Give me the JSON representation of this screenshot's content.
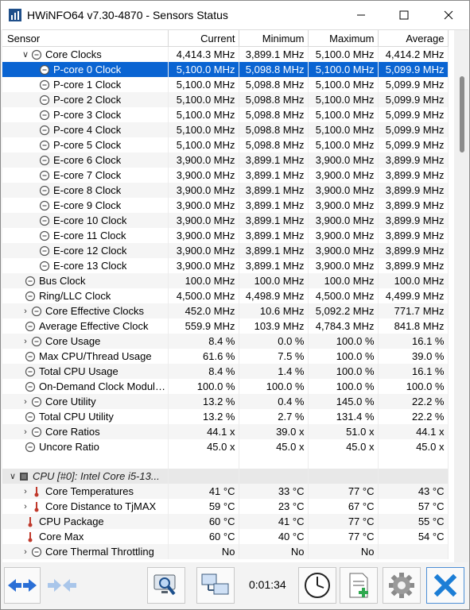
{
  "window": {
    "title": "HWiNFO64 v7.30-4870 - Sensors Status"
  },
  "columns": [
    "Sensor",
    "Current",
    "Minimum",
    "Maximum",
    "Average"
  ],
  "rows": [
    {
      "indent": 1,
      "expander": "v",
      "icon": "clock-icon",
      "name": "Core Clocks",
      "current": "4,414.3 MHz",
      "minimum": "3,899.1 MHz",
      "maximum": "5,100.0 MHz",
      "average": "4,414.2 MHz",
      "selected": false
    },
    {
      "indent": 2,
      "expander": "",
      "icon": "clock-icon",
      "name": "P-core 0 Clock",
      "current": "5,100.0 MHz",
      "minimum": "5,098.8 MHz",
      "maximum": "5,100.0 MHz",
      "average": "5,099.9 MHz",
      "selected": true
    },
    {
      "indent": 2,
      "expander": "",
      "icon": "clock-icon",
      "name": "P-core 1 Clock",
      "current": "5,100.0 MHz",
      "minimum": "5,098.8 MHz",
      "maximum": "5,100.0 MHz",
      "average": "5,099.9 MHz",
      "selected": false
    },
    {
      "indent": 2,
      "expander": "",
      "icon": "clock-icon",
      "name": "P-core 2 Clock",
      "current": "5,100.0 MHz",
      "minimum": "5,098.8 MHz",
      "maximum": "5,100.0 MHz",
      "average": "5,099.9 MHz",
      "selected": false
    },
    {
      "indent": 2,
      "expander": "",
      "icon": "clock-icon",
      "name": "P-core 3 Clock",
      "current": "5,100.0 MHz",
      "minimum": "5,098.8 MHz",
      "maximum": "5,100.0 MHz",
      "average": "5,099.9 MHz",
      "selected": false
    },
    {
      "indent": 2,
      "expander": "",
      "icon": "clock-icon",
      "name": "P-core 4 Clock",
      "current": "5,100.0 MHz",
      "minimum": "5,098.8 MHz",
      "maximum": "5,100.0 MHz",
      "average": "5,099.9 MHz",
      "selected": false
    },
    {
      "indent": 2,
      "expander": "",
      "icon": "clock-icon",
      "name": "P-core 5 Clock",
      "current": "5,100.0 MHz",
      "minimum": "5,098.8 MHz",
      "maximum": "5,100.0 MHz",
      "average": "5,099.9 MHz",
      "selected": false
    },
    {
      "indent": 2,
      "expander": "",
      "icon": "clock-icon",
      "name": "E-core 6 Clock",
      "current": "3,900.0 MHz",
      "minimum": "3,899.1 MHz",
      "maximum": "3,900.0 MHz",
      "average": "3,899.9 MHz",
      "selected": false
    },
    {
      "indent": 2,
      "expander": "",
      "icon": "clock-icon",
      "name": "E-core 7 Clock",
      "current": "3,900.0 MHz",
      "minimum": "3,899.1 MHz",
      "maximum": "3,900.0 MHz",
      "average": "3,899.9 MHz",
      "selected": false
    },
    {
      "indent": 2,
      "expander": "",
      "icon": "clock-icon",
      "name": "E-core 8 Clock",
      "current": "3,900.0 MHz",
      "minimum": "3,899.1 MHz",
      "maximum": "3,900.0 MHz",
      "average": "3,899.9 MHz",
      "selected": false
    },
    {
      "indent": 2,
      "expander": "",
      "icon": "clock-icon",
      "name": "E-core 9 Clock",
      "current": "3,900.0 MHz",
      "minimum": "3,899.1 MHz",
      "maximum": "3,900.0 MHz",
      "average": "3,899.9 MHz",
      "selected": false
    },
    {
      "indent": 2,
      "expander": "",
      "icon": "clock-icon",
      "name": "E-core 10 Clock",
      "current": "3,900.0 MHz",
      "minimum": "3,899.1 MHz",
      "maximum": "3,900.0 MHz",
      "average": "3,899.9 MHz",
      "selected": false
    },
    {
      "indent": 2,
      "expander": "",
      "icon": "clock-icon",
      "name": "E-core 11 Clock",
      "current": "3,900.0 MHz",
      "minimum": "3,899.1 MHz",
      "maximum": "3,900.0 MHz",
      "average": "3,899.9 MHz",
      "selected": false
    },
    {
      "indent": 2,
      "expander": "",
      "icon": "clock-icon",
      "name": "E-core 12 Clock",
      "current": "3,900.0 MHz",
      "minimum": "3,899.1 MHz",
      "maximum": "3,900.0 MHz",
      "average": "3,899.9 MHz",
      "selected": false
    },
    {
      "indent": 2,
      "expander": "",
      "icon": "clock-icon",
      "name": "E-core 13 Clock",
      "current": "3,900.0 MHz",
      "minimum": "3,899.1 MHz",
      "maximum": "3,900.0 MHz",
      "average": "3,899.9 MHz",
      "selected": false
    },
    {
      "indent": 0,
      "expander": "",
      "icon": "clock-icon",
      "name": "Bus Clock",
      "current": "100.0 MHz",
      "minimum": "100.0 MHz",
      "maximum": "100.0 MHz",
      "average": "100.0 MHz",
      "selected": false
    },
    {
      "indent": 0,
      "expander": "",
      "icon": "clock-icon",
      "name": "Ring/LLC Clock",
      "current": "4,500.0 MHz",
      "minimum": "4,498.9 MHz",
      "maximum": "4,500.0 MHz",
      "average": "4,499.9 MHz",
      "selected": false
    },
    {
      "indent": 1,
      "expander": ">",
      "icon": "clock-icon",
      "name": "Core Effective Clocks",
      "current": "452.0 MHz",
      "minimum": "10.6 MHz",
      "maximum": "5,092.2 MHz",
      "average": "771.7 MHz",
      "selected": false
    },
    {
      "indent": 0,
      "expander": "",
      "icon": "clock-icon",
      "name": "Average Effective Clock",
      "current": "559.9 MHz",
      "minimum": "103.9 MHz",
      "maximum": "4,784.3 MHz",
      "average": "841.8 MHz",
      "selected": false
    },
    {
      "indent": 1,
      "expander": ">",
      "icon": "clock-icon",
      "name": "Core Usage",
      "current": "8.4 %",
      "minimum": "0.0 %",
      "maximum": "100.0 %",
      "average": "16.1 %",
      "selected": false
    },
    {
      "indent": 0,
      "expander": "",
      "icon": "clock-icon",
      "name": "Max CPU/Thread Usage",
      "current": "61.6 %",
      "minimum": "7.5 %",
      "maximum": "100.0 %",
      "average": "39.0 %",
      "selected": false
    },
    {
      "indent": 0,
      "expander": "",
      "icon": "clock-icon",
      "name": "Total CPU Usage",
      "current": "8.4 %",
      "minimum": "1.4 %",
      "maximum": "100.0 %",
      "average": "16.1 %",
      "selected": false
    },
    {
      "indent": 0,
      "expander": "",
      "icon": "clock-icon",
      "name": "On-Demand Clock Modulat...",
      "current": "100.0 %",
      "minimum": "100.0 %",
      "maximum": "100.0 %",
      "average": "100.0 %",
      "selected": false
    },
    {
      "indent": 1,
      "expander": ">",
      "icon": "clock-icon",
      "name": "Core Utility",
      "current": "13.2 %",
      "minimum": "0.4 %",
      "maximum": "145.0 %",
      "average": "22.2 %",
      "selected": false
    },
    {
      "indent": 0,
      "expander": "",
      "icon": "clock-icon",
      "name": "Total CPU Utility",
      "current": "13.2 %",
      "minimum": "2.7 %",
      "maximum": "131.4 %",
      "average": "22.2 %",
      "selected": false
    },
    {
      "indent": 1,
      "expander": ">",
      "icon": "clock-icon",
      "name": "Core Ratios",
      "current": "44.1 x",
      "minimum": "39.0 x",
      "maximum": "51.0 x",
      "average": "44.1 x",
      "selected": false
    },
    {
      "indent": 0,
      "expander": "",
      "icon": "clock-icon",
      "name": "Uncore Ratio",
      "current": "45.0 x",
      "minimum": "45.0 x",
      "maximum": "45.0 x",
      "average": "45.0 x",
      "selected": false
    },
    {
      "type": "spacer"
    },
    {
      "type": "group",
      "expander": "v",
      "icon": "chip-icon",
      "name": "CPU [#0]: Intel Core i5-13..."
    },
    {
      "indent": 1,
      "expander": ">",
      "icon": "thermometer-icon",
      "name": "Core Temperatures",
      "current": "41 °C",
      "minimum": "33 °C",
      "maximum": "77 °C",
      "average": "43 °C",
      "selected": false
    },
    {
      "indent": 1,
      "expander": ">",
      "icon": "thermometer-icon",
      "name": "Core Distance to TjMAX",
      "current": "59 °C",
      "minimum": "23 °C",
      "maximum": "67 °C",
      "average": "57 °C",
      "selected": false
    },
    {
      "indent": 0,
      "expander": "",
      "icon": "thermometer-icon",
      "name": "CPU Package",
      "current": "60 °C",
      "minimum": "41 °C",
      "maximum": "77 °C",
      "average": "55 °C",
      "selected": false
    },
    {
      "indent": 0,
      "expander": "",
      "icon": "thermometer-icon",
      "name": "Core Max",
      "current": "60 °C",
      "minimum": "40 °C",
      "maximum": "77 °C",
      "average": "54 °C",
      "selected": false
    },
    {
      "indent": 1,
      "expander": ">",
      "icon": "clock-icon",
      "name": "Core Thermal Throttling",
      "current": "No",
      "minimum": "No",
      "maximum": "No",
      "average": "",
      "selected": false
    }
  ],
  "toolbar": {
    "timer": "0:01:34"
  },
  "colors": {
    "selection": "#0a64d2",
    "close_x": "#1c7ed6"
  }
}
